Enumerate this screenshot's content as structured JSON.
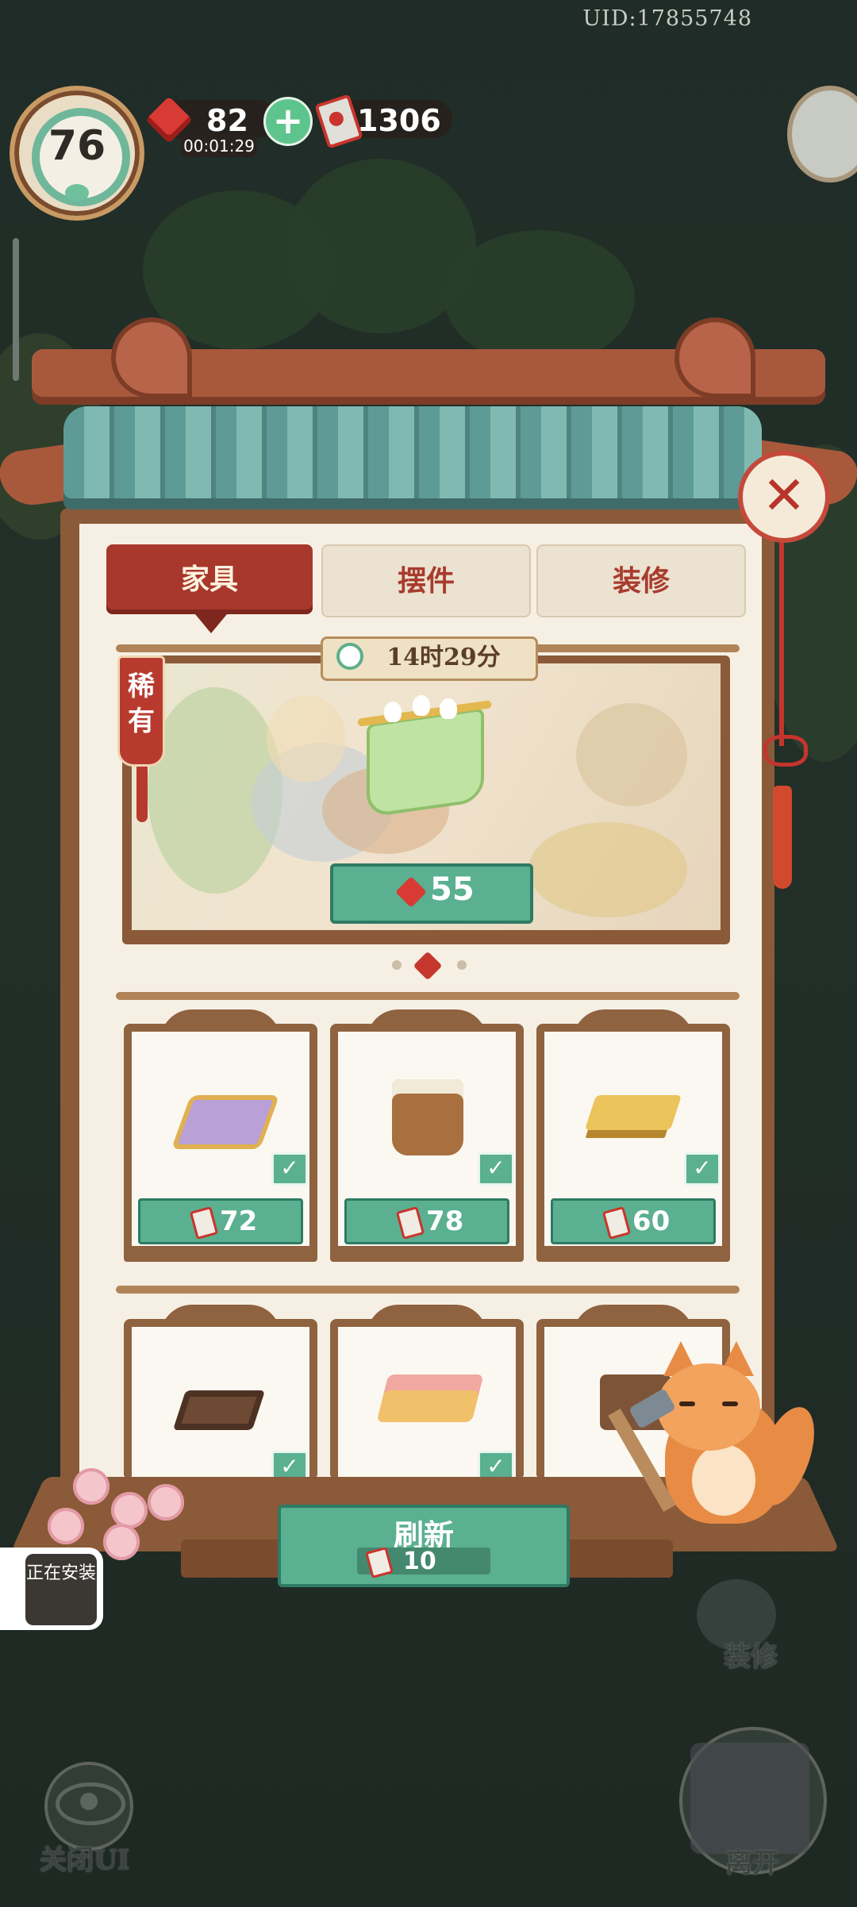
{
  "header": {
    "uid": "UID:17855748"
  },
  "hud": {
    "level": "76",
    "gems": "82",
    "gem_timer": "00:01:29",
    "tickets": "1306",
    "add_label": "+"
  },
  "tabs": [
    {
      "label": "家具",
      "active": true
    },
    {
      "label": "摆件",
      "active": false
    },
    {
      "label": "装修",
      "active": false
    }
  ],
  "featured": {
    "timer": "14时29分",
    "rarity": "稀有",
    "price": "55",
    "page_count": 3,
    "page_active": 2
  },
  "shop_items": [
    {
      "name": "lotus-cushion",
      "price": "72",
      "owned": true
    },
    {
      "name": "rice-bucket",
      "price": "78",
      "owned": true
    },
    {
      "name": "wooden-stool",
      "price": "60",
      "owned": true
    },
    {
      "name": "low-tea-table",
      "price": "",
      "owned": true
    },
    {
      "name": "writing-desk",
      "price": "",
      "owned": true
    },
    {
      "name": "wooden-chest",
      "price": "",
      "owned": false
    }
  ],
  "refresh": {
    "label": "刷新",
    "cost": "10"
  },
  "bottom": {
    "installing": "正在安装",
    "close_ui": "关闭UI",
    "renovate": "装修",
    "leave": "离开"
  },
  "colors": {
    "accent_red": "#a7382b",
    "button_green": "#5ab090",
    "panel_bg": "#f6f0e4",
    "wood": "#8a5a39"
  },
  "icons": {
    "gem": "red-gem-icon",
    "ticket": "red-ticket-icon",
    "close": "close-icon",
    "check": "check-icon"
  }
}
